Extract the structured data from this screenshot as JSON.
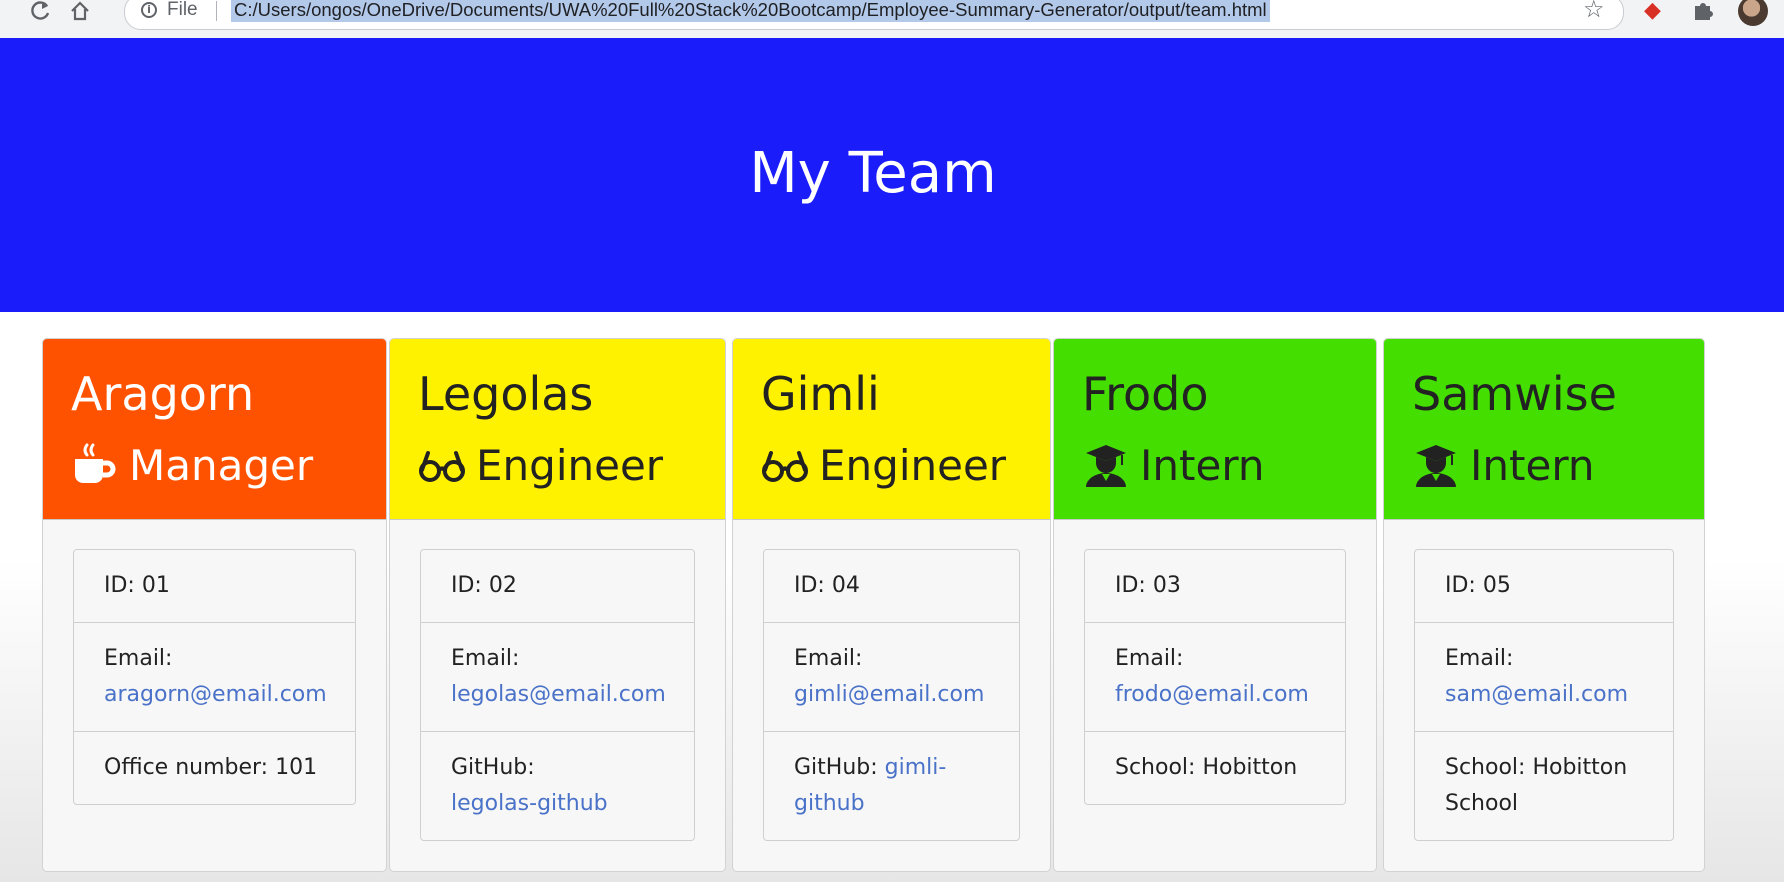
{
  "browser": {
    "file_label": "File",
    "url": "C:/Users/ongos/OneDrive/Documents/UWA%20Full%20Stack%20Bootcamp/Employee-Summary-Generator/output/team.html",
    "icons": [
      "reload-icon",
      "home-icon",
      "info-icon",
      "star-icon",
      "extension-icon",
      "puzzle-icon",
      "profile-avatar"
    ]
  },
  "header": {
    "title": "My Team",
    "background": "#1a1dfa"
  },
  "colors": {
    "manager": "#ff5200",
    "engineer": "#fff200",
    "intern": "#44df00",
    "link": "#4a72c8"
  },
  "employees": [
    {
      "name": "Aragorn",
      "role": "Manager",
      "icon": "mug-icon",
      "id": "ID: 01",
      "email_label": "Email:",
      "email": "aragorn@email.com",
      "extra_label": "Office number: 101",
      "extra_value": ""
    },
    {
      "name": "Legolas",
      "role": "Engineer",
      "icon": "glasses-icon",
      "id": "ID: 02",
      "email_label": "Email:",
      "email": "legolas@email.com",
      "extra_label": "GitHub:",
      "extra_value": "legolas-github"
    },
    {
      "name": "Gimli",
      "role": "Engineer",
      "icon": "glasses-icon",
      "id": "ID: 04",
      "email_label": "Email:",
      "email": "gimli@email.com",
      "extra_label": "GitHub:",
      "extra_value": "gimli-github"
    },
    {
      "name": "Frodo",
      "role": "Intern",
      "icon": "graduate-icon",
      "id": "ID: 03",
      "email_label": "Email:",
      "email": "frodo@email.com",
      "extra_label": "School: Hobitton",
      "extra_value": ""
    },
    {
      "name": "Samwise",
      "role": "Intern",
      "icon": "graduate-icon",
      "id": "ID: 05",
      "email_label": "Email:",
      "email": "sam@email.com",
      "extra_label": "School: Hobitton School",
      "extra_value": ""
    }
  ]
}
